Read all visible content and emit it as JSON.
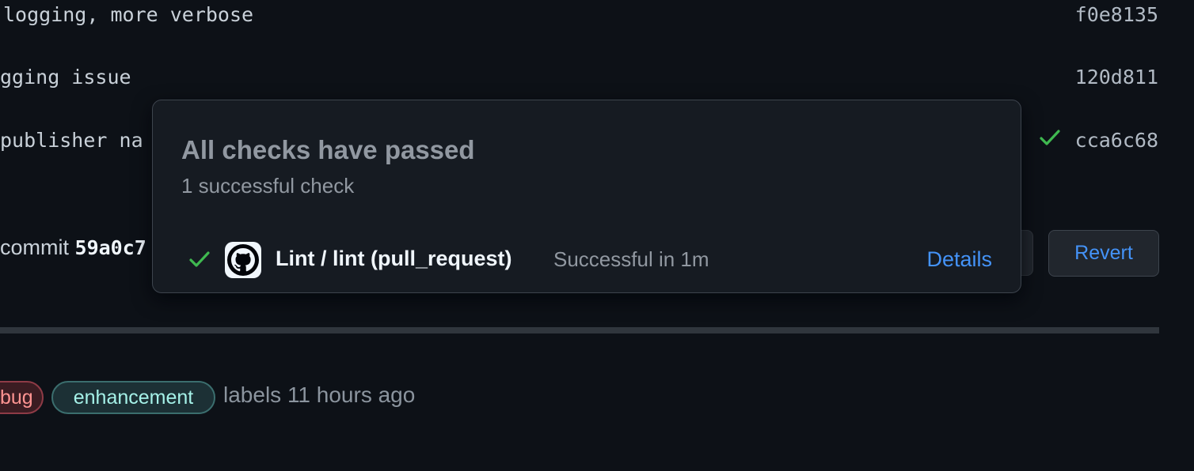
{
  "commits": [
    {
      "message": "logging, more verbose",
      "sha": "f0e8135"
    },
    {
      "message": "gging issue",
      "sha": "120d811"
    },
    {
      "message": "publisher na",
      "sha": "cca6c68",
      "status": "success"
    }
  ],
  "commit_line": {
    "prefix": "commit",
    "hash": "59a0c7"
  },
  "actions": {
    "revert_label": "Revert"
  },
  "labels_event": {
    "labels": [
      {
        "name": "bug",
        "color": "#ff9492"
      },
      {
        "name": "enhancement",
        "color": "#a5f1e8"
      }
    ],
    "text": "labels 11 hours ago"
  },
  "popover": {
    "title": "All checks have passed",
    "subtitle": "1 successful check",
    "checks": [
      {
        "name": "Lint / lint (pull_request)",
        "status": "Successful in 1m",
        "details_label": "Details",
        "icon": "github-icon"
      }
    ]
  },
  "colors": {
    "success": "#3fb950",
    "link": "#4493f8",
    "background": "#0d1117"
  }
}
